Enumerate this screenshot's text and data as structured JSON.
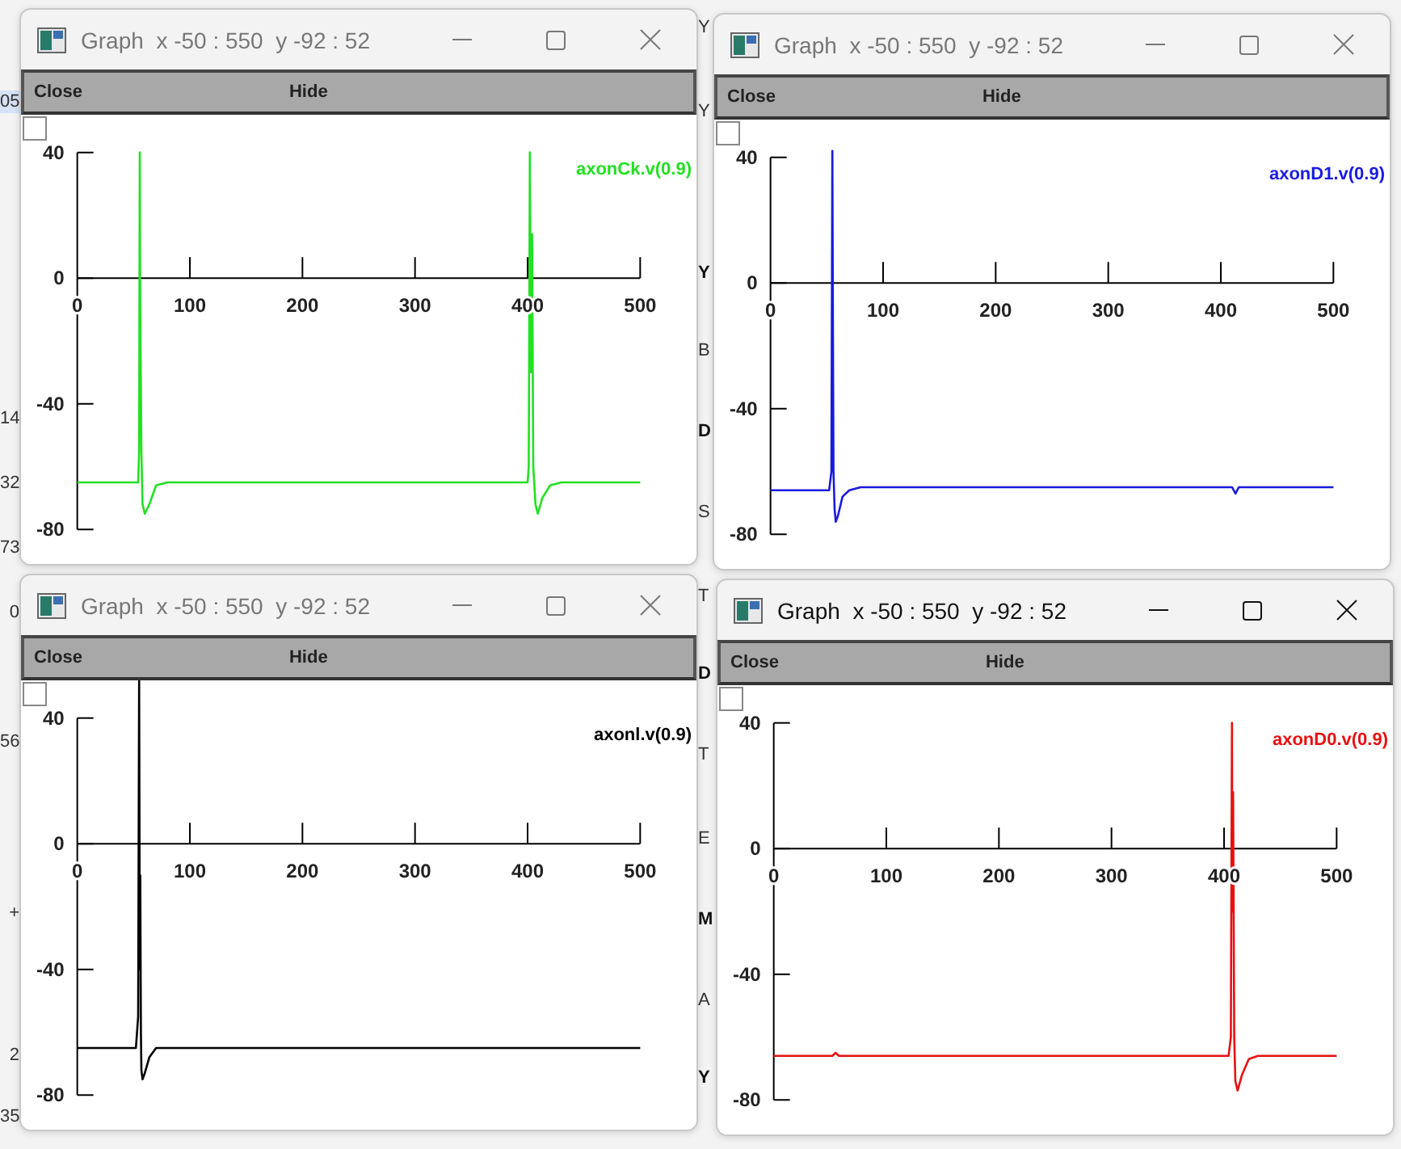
{
  "background_fragments": {
    "left": [
      {
        "text": "05",
        "highlighted": true
      },
      {
        "text": "14",
        "highlighted": false
      },
      {
        "text": "32",
        "highlighted": false
      },
      {
        "text": "73",
        "highlighted": false
      },
      {
        "text": "0",
        "highlighted": false
      },
      {
        "text": "56",
        "highlighted": false
      },
      {
        "text": "+",
        "highlighted": false
      },
      {
        "text": "2",
        "highlighted": false
      },
      {
        "text": "35",
        "highlighted": false
      }
    ],
    "middle": [
      {
        "text": "Y",
        "bold": false
      },
      {
        "text": "Y",
        "bold": false
      },
      {
        "text": "Y",
        "bold": true
      },
      {
        "text": "B",
        "bold": false
      },
      {
        "text": "D",
        "bold": true
      },
      {
        "text": "S",
        "bold": false
      },
      {
        "text": "T",
        "bold": false
      },
      {
        "text": "D",
        "bold": true
      },
      {
        "text": "T",
        "bold": false
      },
      {
        "text": "E",
        "bold": false
      },
      {
        "text": "M",
        "bold": true
      },
      {
        "text": "A",
        "bold": false
      },
      {
        "text": "Y",
        "bold": true
      }
    ]
  },
  "windows": [
    {
      "title": "Graph  x -50 : 550  y -92 : 52",
      "active": false,
      "menu": [
        "Close",
        "Hide"
      ],
      "checked": false,
      "chart_data": {
        "type": "line",
        "xlim": [
          -50,
          550
        ],
        "ylim": [
          -92,
          52
        ],
        "xticks": [
          0,
          100,
          200,
          300,
          400,
          500
        ],
        "yticks": [
          40,
          0,
          -40,
          -80
        ],
        "x": [
          0,
          54,
          55,
          55.5,
          56,
          57,
          58,
          60,
          64,
          70,
          80,
          400,
          401,
          402,
          403,
          404,
          405,
          407,
          409,
          413,
          420,
          430,
          500
        ],
        "series": [
          {
            "name": "axonCk.v(0.9)",
            "color": "#22e022",
            "values": [
              -65,
              -65,
              -55,
              40,
              -10,
              -55,
              -72,
              -75,
              -72,
              -66,
              -65,
              -65,
              -60,
              40,
              -30,
              14,
              -60,
              -72,
              -75,
              -70,
              -66,
              -65,
              -65
            ]
          }
        ]
      }
    },
    {
      "title": "Graph  x -50 : 550  y -92 : 52",
      "active": false,
      "menu": [
        "Close",
        "Hide"
      ],
      "checked": false,
      "chart_data": {
        "type": "line",
        "xlim": [
          -50,
          550
        ],
        "ylim": [
          -92,
          52
        ],
        "xticks": [
          0,
          100,
          200,
          300,
          400,
          500
        ],
        "yticks": [
          40,
          0,
          -40,
          -80
        ],
        "x": [
          0,
          52,
          54,
          55,
          55.5,
          56,
          57,
          58,
          60,
          64,
          70,
          80,
          410,
          413,
          416,
          500
        ],
        "series": [
          {
            "name": "axonD1.v(0.9)",
            "color": "#1a1ae0",
            "values": [
              -66,
              -66,
              -60,
              42,
              -20,
              -60,
              -72,
              -76,
              -74,
              -68,
              -66,
              -65,
              -65,
              -67,
              -65,
              -65
            ]
          }
        ]
      }
    },
    {
      "title": "Graph  x -50 : 550  y -92 : 52",
      "active": false,
      "menu": [
        "Close",
        "Hide"
      ],
      "checked": false,
      "chart_data": {
        "type": "line",
        "xlim": [
          -50,
          550
        ],
        "ylim": [
          -92,
          52
        ],
        "xticks": [
          0,
          100,
          200,
          300,
          400,
          500
        ],
        "yticks": [
          40,
          0,
          -40,
          -80
        ],
        "x": [
          0,
          52,
          54,
          55,
          55.5,
          56,
          56.5,
          57,
          58,
          60,
          64,
          70,
          80,
          500
        ],
        "series": [
          {
            "name": "axonl.v(0.9)",
            "color": "#000000",
            "values": [
              -65,
              -65,
              -55,
              52,
              -40,
              -10,
              -60,
              -72,
              -75,
              -73,
              -68,
              -65,
              -65,
              -65
            ]
          }
        ]
      }
    },
    {
      "title": "Graph  x -50 : 550  y -92 : 52",
      "active": true,
      "menu": [
        "Close",
        "Hide"
      ],
      "checked": false,
      "chart_data": {
        "type": "line",
        "xlim": [
          -50,
          550
        ],
        "ylim": [
          -92,
          52
        ],
        "xticks": [
          0,
          100,
          200,
          300,
          400,
          500
        ],
        "yticks": [
          40,
          0,
          -40,
          -80
        ],
        "x": [
          0,
          52,
          55,
          58,
          404,
          406,
          407,
          407.5,
          408,
          409,
          410,
          412,
          416,
          422,
          430,
          500
        ],
        "series": [
          {
            "name": "axonD0.v(0.9)",
            "color": "#e81010",
            "values": [
              -66,
              -66,
              -65,
              -66,
              -66,
              -60,
              40,
              -20,
              18,
              -60,
              -74,
              -77,
              -72,
              -67,
              -66,
              -66
            ]
          }
        ]
      }
    }
  ]
}
